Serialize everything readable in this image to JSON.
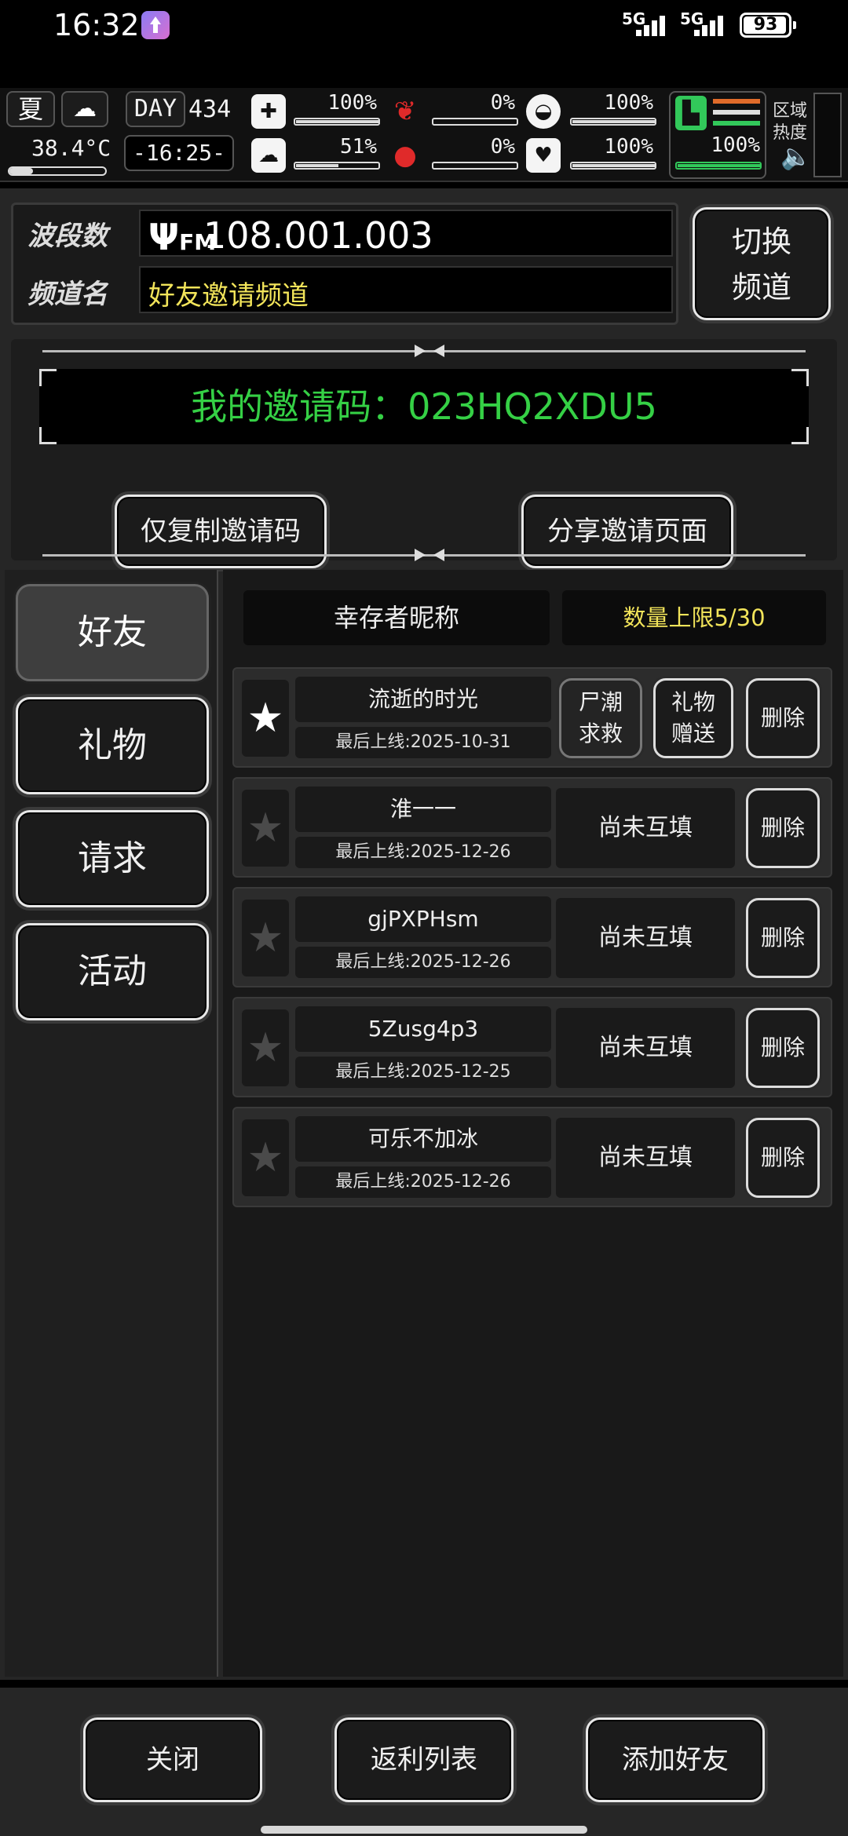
{
  "status_bar": {
    "time": "16:32",
    "network_1": "5G",
    "network_2": "5G",
    "battery": "93"
  },
  "hud": {
    "season": "夏",
    "temperature": "38.4°C",
    "day_label": "DAY",
    "day_count": "434",
    "game_time": "-16:25-",
    "stats": [
      {
        "icon": "medkit-icon",
        "value": "100%",
        "level": 1.0
      },
      {
        "icon": "stomach-icon",
        "value": "0%",
        "level": 0.0
      },
      {
        "icon": "pill-icon",
        "value": "100%",
        "level": 1.0
      },
      {
        "icon": "brain-icon",
        "value": "51%",
        "level": 0.51
      },
      {
        "icon": "blood-icon",
        "value": "0%",
        "level": 0.0
      },
      {
        "icon": "heart-icon",
        "value": "100%",
        "level": 1.0
      }
    ],
    "stamina": {
      "value": "100%",
      "level": 1.0
    },
    "zone_heat_label": "区域热度"
  },
  "channel": {
    "band_label": "波段数",
    "frequency": "108.001.003",
    "fm_label": "FM",
    "channel_label": "频道名",
    "channel_name": "好友邀请频道",
    "switch_label_line1": "切换",
    "switch_label_line2": "频道"
  },
  "invite": {
    "code_text": "我的邀请码：023HQ2XDU5",
    "copy_label": "仅复制邀请码",
    "share_label": "分享邀请页面"
  },
  "tabs": [
    {
      "label": "好友",
      "active": true
    },
    {
      "label": "礼物",
      "active": false
    },
    {
      "label": "请求",
      "active": false
    },
    {
      "label": "活动",
      "active": false
    }
  ],
  "friends_header": {
    "name_col": "幸存者昵称",
    "limit": "数量上限5/30"
  },
  "friends": [
    {
      "name": "流逝的时光",
      "last_online": "最后上线:2025-10-31",
      "starred": true,
      "mutual": true,
      "rescue_l1": "尸潮",
      "rescue_l2": "求救",
      "gift_l1": "礼物",
      "gift_l2": "赠送",
      "delete": "删除"
    },
    {
      "name": "淮一一",
      "last_online": "最后上线:2025-12-26",
      "starred": false,
      "mutual": false,
      "pending": "尚未互填",
      "delete": "删除"
    },
    {
      "name": "gjPXPHsm",
      "last_online": "最后上线:2025-12-26",
      "starred": false,
      "mutual": false,
      "pending": "尚未互填",
      "delete": "删除"
    },
    {
      "name": "5Zusg4p3",
      "last_online": "最后上线:2025-12-25",
      "starred": false,
      "mutual": false,
      "pending": "尚未互填",
      "delete": "删除"
    },
    {
      "name": "可乐不加冰",
      "last_online": "最后上线:2025-12-26",
      "starred": false,
      "mutual": false,
      "pending": "尚未互填",
      "delete": "删除"
    }
  ],
  "bottom": {
    "close": "关闭",
    "rebate": "返利列表",
    "add_friend": "添加好友"
  }
}
